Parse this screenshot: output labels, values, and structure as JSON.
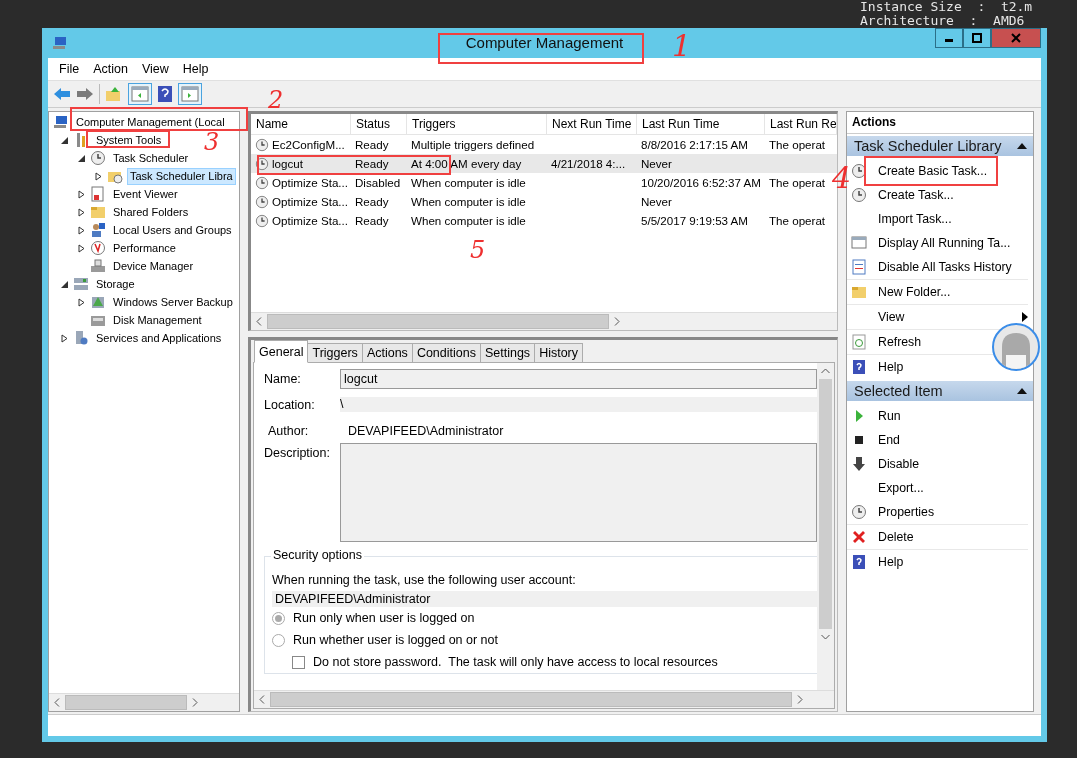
{
  "terminal": {
    "lines": [
      "Instance Size  :  t2.m",
      "Architecture  :  AMD6"
    ]
  },
  "window": {
    "title": "Computer Management"
  },
  "menu": [
    "File",
    "Action",
    "View",
    "Help"
  ],
  "tree": [
    {
      "label": "Computer Management (Local",
      "kind": "root",
      "selected": false,
      "children": [
        {
          "label": "System Tools",
          "kind": "branch",
          "expanded": true,
          "selected": false,
          "children": [
            {
              "label": "Task Scheduler",
              "kind": "branch",
              "expanded": true,
              "selected": false,
              "children": [
                {
                  "label": "Task Scheduler Libra",
                  "kind": "branch",
                  "expanded": false,
                  "selected": true
                }
              ]
            },
            {
              "label": "Event Viewer",
              "kind": "branch",
              "expanded": false,
              "selected": false
            },
            {
              "label": "Shared Folders",
              "kind": "branch",
              "expanded": false,
              "selected": false
            },
            {
              "label": "Local Users and Groups",
              "kind": "branch",
              "expanded": false,
              "selected": false
            },
            {
              "label": "Performance",
              "kind": "branch",
              "expanded": false,
              "selected": false
            },
            {
              "label": "Device Manager",
              "kind": "leaf",
              "selected": false
            }
          ]
        },
        {
          "label": "Storage",
          "kind": "branch",
          "expanded": true,
          "selected": false,
          "children": [
            {
              "label": "Windows Server Backup",
              "kind": "branch",
              "expanded": false,
              "selected": false
            },
            {
              "label": "Disk Management",
              "kind": "leaf",
              "selected": false
            }
          ]
        },
        {
          "label": "Services and Applications",
          "kind": "branch",
          "expanded": false,
          "selected": false
        }
      ]
    }
  ],
  "table": {
    "columns": [
      "Name",
      "Status",
      "Triggers",
      "Next Run Time",
      "Last Run Time",
      "Last Run Re"
    ],
    "rows": [
      {
        "selected": false,
        "name": "Ec2ConfigM...",
        "status": "Ready",
        "triggers": "Multiple triggers defined",
        "last_run_time": "8/8/2016 2:17:15 AM",
        "column_6": "The operat"
      },
      {
        "selected": true,
        "name": "logcut",
        "status": "Ready",
        "triggers": "At 4:00 AM every day",
        "next_run_time": "4/21/2018 4:...",
        "last_run_time": "Never"
      },
      {
        "selected": false,
        "name": "Optimize Sta...",
        "status": "Disabled",
        "triggers": "When computer is idle",
        "last_run_time": "10/20/2016 6:52:37 AM",
        "column_6": "The operat"
      },
      {
        "selected": false,
        "name": "Optimize Sta...",
        "status": "Ready",
        "triggers": "When computer is idle",
        "last_run_time": "Never"
      },
      {
        "selected": false,
        "name": "Optimize Sta...",
        "status": "Ready",
        "triggers": "When computer is idle",
        "last_run_time": "5/5/2017 9:19:53 AM",
        "column_6": "The operat"
      }
    ]
  },
  "details": {
    "tabs": [
      {
        "label": "General",
        "selected": true
      },
      {
        "label": "Triggers",
        "selected": false
      },
      {
        "label": "Actions",
        "selected": false
      },
      {
        "label": "Conditions",
        "selected": false
      },
      {
        "label": "Settings",
        "selected": false
      },
      {
        "label": "History",
        "selected": false
      }
    ],
    "fields": [
      {
        "label": "Name:",
        "kind": "input",
        "value": "logcut"
      },
      {
        "label": "Location:",
        "kind": "readonly",
        "value": "\\"
      },
      {
        "label": "Author:",
        "kind": "plain",
        "value": "DEVAPIFEED\\Administrator"
      },
      {
        "label": "Description:",
        "kind": "textarea"
      }
    ],
    "security": {
      "title": "Security options",
      "prompt": "When running the task, use the following user account:",
      "account": "DEVAPIFEED\\Administrator",
      "options": [
        {
          "label": "Run only when user is logged on",
          "selected": true
        },
        {
          "label": "Run whether user is logged on or not",
          "selected": false
        }
      ],
      "checkbox": {
        "label": "Do not store password.  The task will only have access to local resources",
        "checked": false
      }
    }
  },
  "actions": {
    "title": "Actions",
    "sections": [
      {
        "title": "Task Scheduler Library",
        "expanded": true,
        "items": [
          {
            "label": "Create Basic Task...",
            "kind": "command"
          },
          {
            "label": "Create Task...",
            "kind": "command"
          },
          {
            "label": "Import Task...",
            "kind": "command"
          },
          {
            "label": "Display All Running Ta...",
            "kind": "command"
          },
          {
            "label": "Disable All Tasks History",
            "kind": "command"
          },
          {
            "label": "New Folder...",
            "kind": "command"
          },
          {
            "label": "View",
            "kind": "submenu"
          },
          {
            "label": "Refresh",
            "kind": "command"
          },
          {
            "label": "Help",
            "kind": "command"
          }
        ]
      },
      {
        "title": "Selected Item",
        "expanded": true,
        "items": [
          {
            "label": "Run",
            "kind": "command"
          },
          {
            "label": "End",
            "kind": "command"
          },
          {
            "label": "Disable",
            "kind": "command"
          },
          {
            "label": "Export...",
            "kind": "command"
          },
          {
            "label": "Properties",
            "kind": "command"
          },
          {
            "label": "Delete",
            "kind": "command"
          },
          {
            "label": "Help",
            "kind": "command"
          }
        ]
      }
    ]
  },
  "annotations": [
    {
      "label": "1"
    },
    {
      "label": "2"
    },
    {
      "label": "3"
    },
    {
      "label": "4"
    },
    {
      "label": "5"
    }
  ]
}
